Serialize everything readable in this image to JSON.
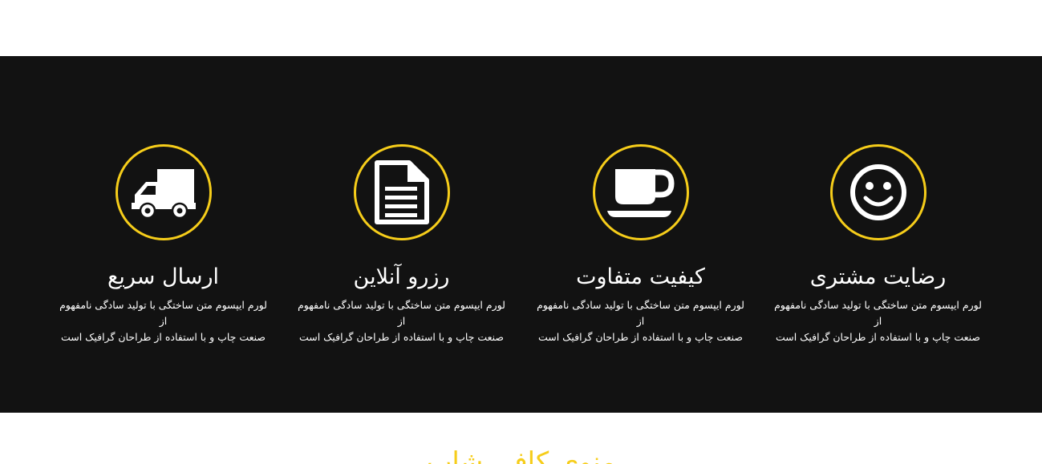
{
  "colors": {
    "background_dark": "#121212",
    "accent": "#f6cd1a",
    "text": "#ffffff"
  },
  "features": [
    {
      "icon": "truck-icon",
      "title": "ارسال سریع",
      "line1": "لورم ایپسوم متن ساختگی با تولید سادگی نامفهوم از",
      "line2": "صنعت چاپ و با استفاده از طراحان گرافیک است"
    },
    {
      "icon": "document-icon",
      "title": "رزرو آنلاین",
      "line1": "لورم ایپسوم متن ساختگی با تولید سادگی نامفهوم از",
      "line2": "صنعت چاپ و با استفاده از طراحان گرافیک است"
    },
    {
      "icon": "coffee-cup-icon",
      "title": "کیفیت متفاوت",
      "line1": "لورم ایپسوم متن ساختگی با تولید سادگی نامفهوم از",
      "line2": "صنعت چاپ و با استفاده از طراحان گرافیک است"
    },
    {
      "icon": "smiley-icon",
      "title": "رضایت مشتری",
      "line1": "لورم ایپسوم متن ساختگی با تولید سادگی نامفهوم از",
      "line2": "صنعت چاپ و با استفاده از طراحان گرافیک است"
    }
  ],
  "next_section": {
    "heading": "منوی کافی شاپ"
  }
}
